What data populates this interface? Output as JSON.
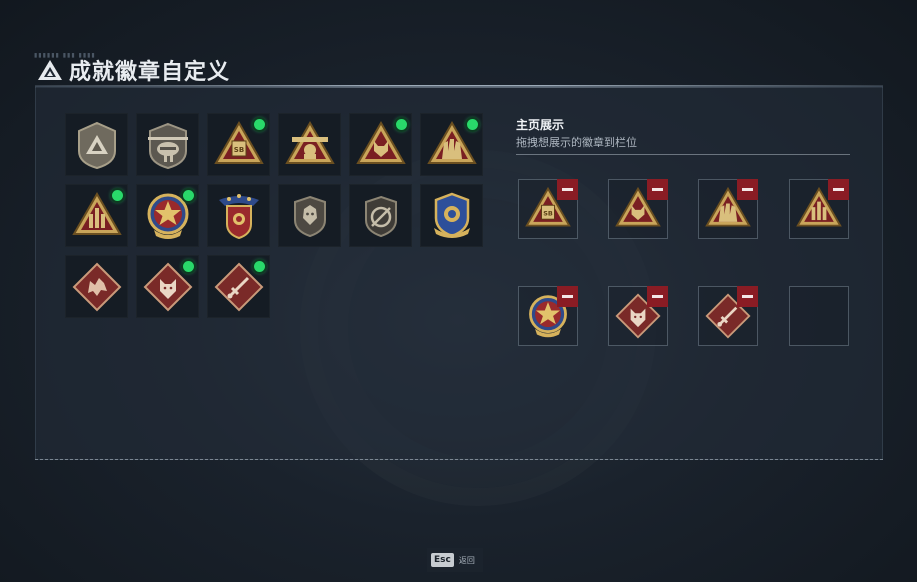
{
  "header": {
    "title": "成就徽章自定义",
    "faint_text": "▮▮▮▮▮▮ ▮▮▮ ▮▮▮▮"
  },
  "colors": {
    "gold": "#c9a55a",
    "crimson": "#7a1f22",
    "badge_green": "#29d96a",
    "remove_red": "#8a1c24"
  },
  "collection": {
    "badges": [
      {
        "icon": "grey-shield-triangle-badge-icon",
        "equipped": false
      },
      {
        "icon": "grey-helicopter-badge-icon",
        "equipped": false
      },
      {
        "icon": "gold-sb-triangle-badge-icon",
        "equipped": true
      },
      {
        "icon": "gold-rifle-triangle-badge-icon",
        "equipped": false
      },
      {
        "icon": "gold-wolf-triangle-badge-icon",
        "equipped": true
      },
      {
        "icon": "gold-hands-triangle-badge-icon",
        "equipped": true
      },
      {
        "icon": "gold-bullets-triangle-badge-icon",
        "equipped": true
      },
      {
        "icon": "star-medallion-badge-icon",
        "equipped": true
      },
      {
        "icon": "winged-shield-stars-badge-icon",
        "equipped": false
      },
      {
        "icon": "grey-lion-shield-badge-icon",
        "equipped": false
      },
      {
        "icon": "grey-slash-shield-badge-icon",
        "equipped": false
      },
      {
        "icon": "blue-ornate-shield-badge-icon",
        "equipped": false
      },
      {
        "icon": "red-dragon-diamond-badge-icon",
        "equipped": false
      },
      {
        "icon": "red-wolf-diamond-badge-icon",
        "equipped": true
      },
      {
        "icon": "red-sword-diamond-badge-icon",
        "equipped": true
      }
    ]
  },
  "showcase": {
    "title": "主页展示",
    "subtitle": "拖拽想展示的徽章到栏位",
    "slots": [
      {
        "icon": "gold-sb-triangle-badge-icon",
        "removable": true
      },
      {
        "icon": "gold-wolf-triangle-badge-icon",
        "removable": true
      },
      {
        "icon": "gold-hands-triangle-badge-icon",
        "removable": true
      },
      {
        "icon": "gold-bullets-triangle-badge-icon",
        "removable": true
      },
      {
        "icon": "star-medallion-badge-icon",
        "removable": true
      },
      {
        "icon": "red-wolf-diamond-badge-icon",
        "removable": true
      },
      {
        "icon": "red-sword-diamond-badge-icon",
        "removable": true
      },
      {
        "icon": "empty-slot",
        "removable": false
      }
    ]
  },
  "footer": {
    "esc_key": "Esc",
    "back_label": "返回"
  }
}
